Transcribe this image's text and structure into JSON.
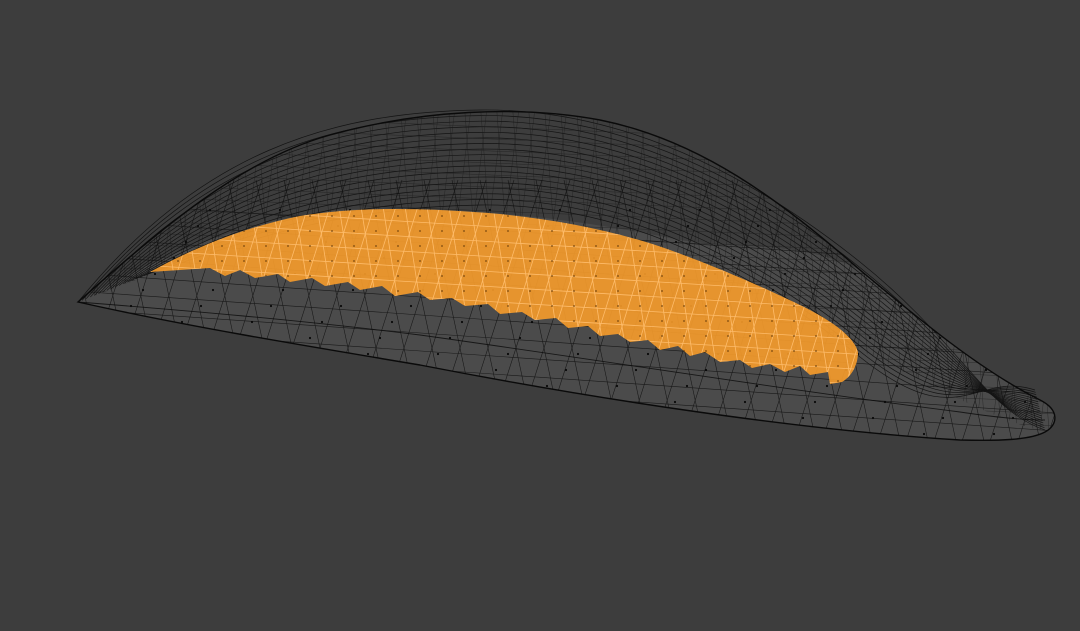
{
  "viewport": {
    "background_color": "#3d3d3d",
    "mode": "edit-mode-wireframe",
    "mesh": {
      "wire_color": "#000000",
      "fill_color": "#4a4a4a",
      "selected_face_color": "#f39a2b",
      "selected_edge_color": "#ffb35c",
      "vertex_color": "#0b0b0b"
    }
  }
}
